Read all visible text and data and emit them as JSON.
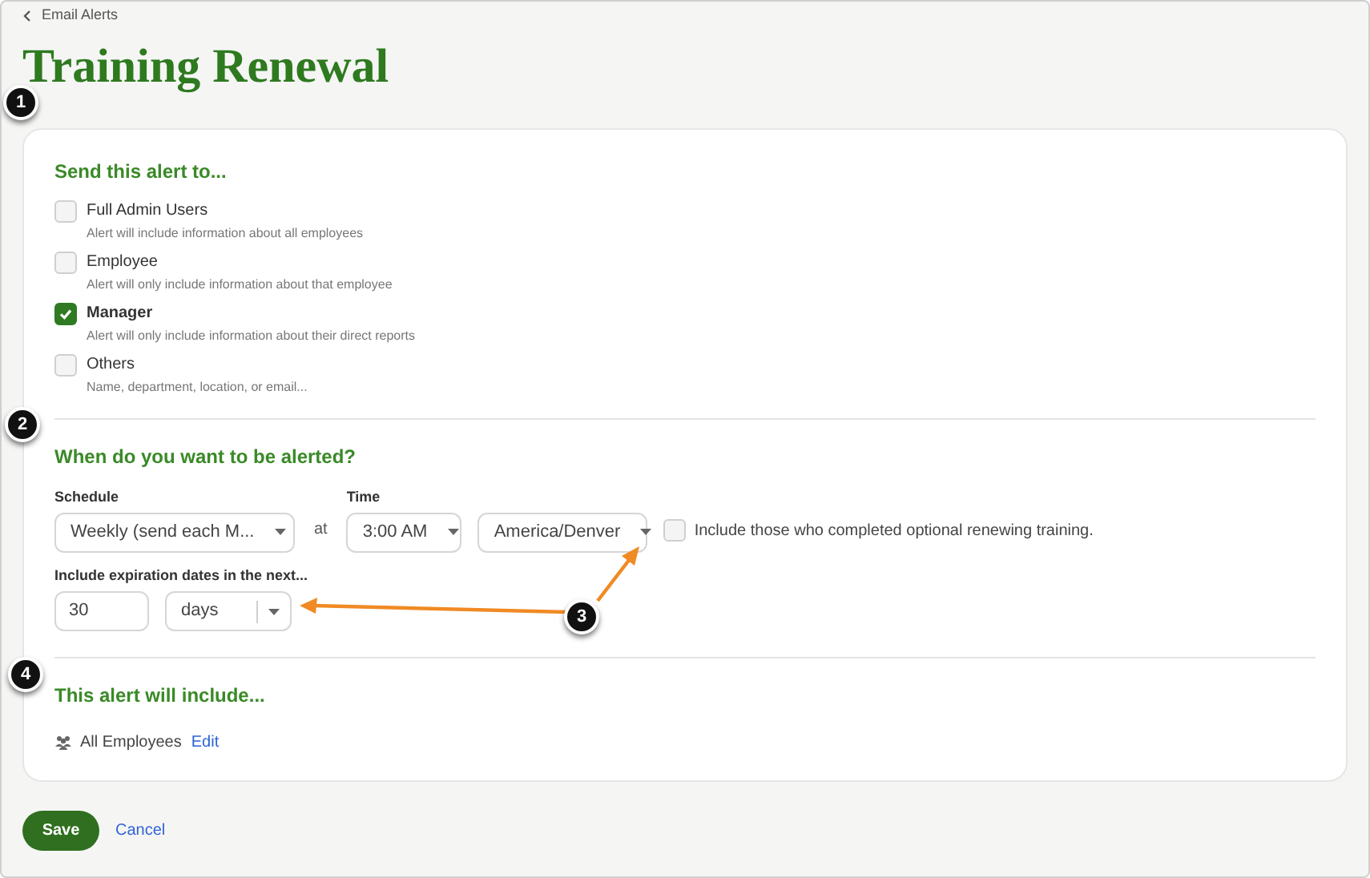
{
  "breadcrumb": {
    "label": "Email Alerts"
  },
  "title": "Training Renewal",
  "recipients": {
    "heading": "Send this alert to...",
    "options": [
      {
        "label": "Full Admin Users",
        "description": "Alert will include information about all employees",
        "checked": false
      },
      {
        "label": "Employee",
        "description": "Alert will only include information about that employee",
        "checked": false
      },
      {
        "label": "Manager",
        "description": "Alert will only include information about their direct reports",
        "checked": true
      },
      {
        "label": "Others",
        "description": "Name, department, location, or email...",
        "checked": false
      }
    ]
  },
  "schedule": {
    "heading": "When do you want to be alerted?",
    "schedule_label": "Schedule",
    "schedule_value": "Weekly (send each M...",
    "at_label": "at",
    "time_label": "Time",
    "time_value": "3:00 AM",
    "timezone_value": "America/Denver",
    "optional_training": {
      "label": "Include those who completed optional renewing training.",
      "checked": false
    },
    "expiration_label": "Include expiration dates in the next...",
    "expiration_amount": "30",
    "expiration_unit": "days"
  },
  "includes": {
    "heading": "This alert will include...",
    "scope": "All Employees",
    "edit_link": "Edit"
  },
  "buttons": {
    "save": "Save",
    "cancel": "Cancel"
  },
  "callouts": [
    {
      "label": "1"
    },
    {
      "label": "2"
    },
    {
      "label": "3"
    },
    {
      "label": "4"
    }
  ]
}
